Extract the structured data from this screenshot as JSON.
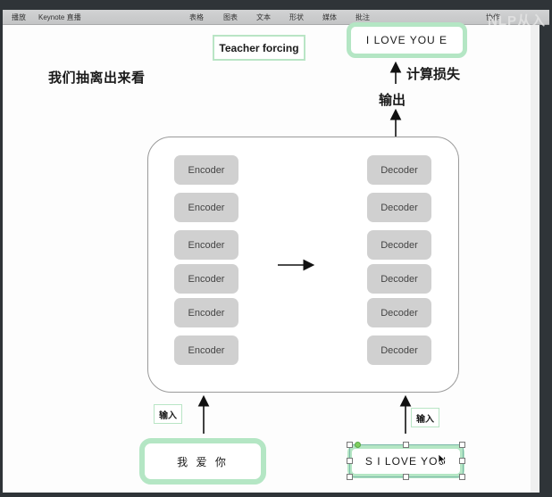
{
  "toolbar": {
    "items": [
      {
        "label": "播放"
      },
      {
        "label": "Keynote 直播"
      },
      {
        "label": "表格"
      },
      {
        "label": "图表"
      },
      {
        "label": "文本"
      },
      {
        "label": "形状"
      },
      {
        "label": "媒体"
      },
      {
        "label": "批注"
      },
      {
        "label": "协作"
      }
    ],
    "watermark": "NLP从入"
  },
  "slide": {
    "heading": "我们抽离出来看",
    "teacher_forcing_label": "Teacher forcing",
    "output_sequence": "I  LOVE  YOU  E",
    "loss_label": "计算损失",
    "output_label": "输出",
    "encoders": [
      "Encoder",
      "Encoder",
      "Encoder",
      "Encoder",
      "Encoder",
      "Encoder"
    ],
    "decoders": [
      "Decoder",
      "Decoder",
      "Decoder",
      "Decoder",
      "Decoder",
      "Decoder"
    ],
    "encoder_input_label": "输入",
    "decoder_input_label": "输入",
    "source_sequence": "我 爱 你",
    "target_input_sequence": "S  I  LOVE  YOU"
  },
  "colors": {
    "accent_green": "#b4e6c4",
    "block_gray": "#d0d0d0",
    "window_dark": "#2f3438"
  },
  "icons": {
    "cursor": "mouse-pointer-icon",
    "arrow": "arrow-icon"
  }
}
